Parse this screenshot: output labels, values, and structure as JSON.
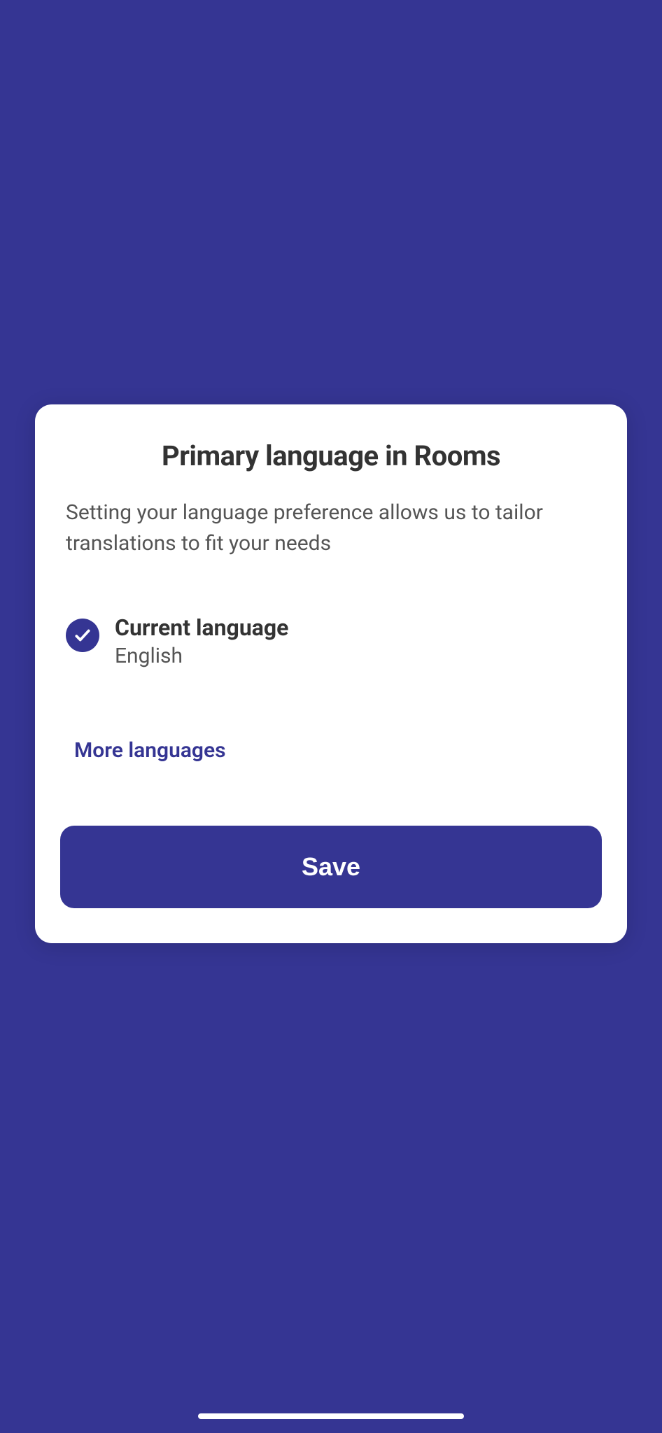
{
  "card": {
    "title": "Primary language in Rooms",
    "description": "Setting your language preference allows us to tailor translations to fit your needs",
    "currentLanguageLabel": "Current language",
    "currentLanguageValue": "English",
    "moreLanguagesLabel": "More languages",
    "saveLabel": "Save"
  }
}
